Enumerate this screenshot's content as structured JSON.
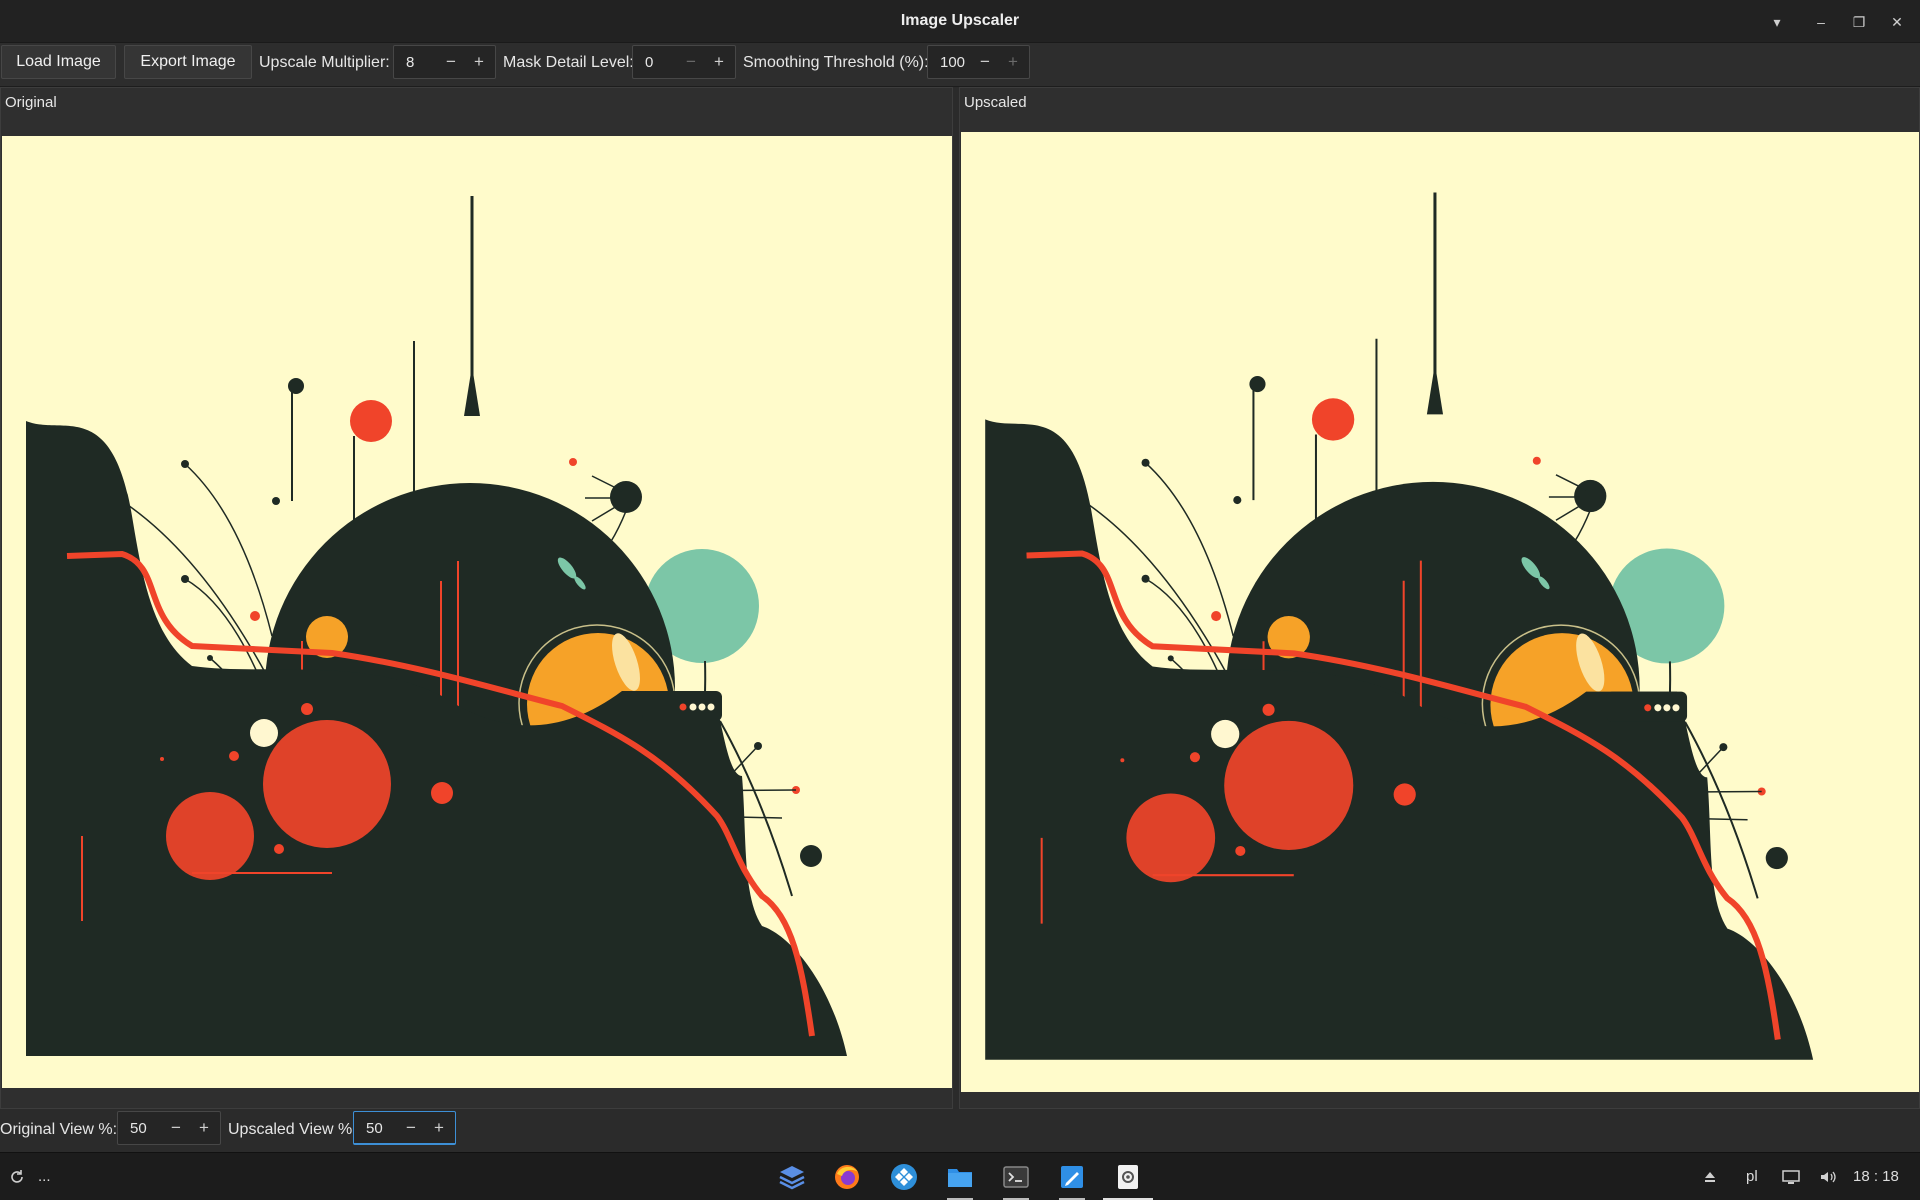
{
  "window": {
    "title": "Image Upscaler"
  },
  "toolbar": {
    "load_label": "Load Image",
    "export_label": "Export Image",
    "upscale_label": "Upscale Multiplier:",
    "upscale_value": "8",
    "mask_label": "Mask Detail Level:",
    "mask_value": "0",
    "smoothing_label": "Smoothing Threshold (%):",
    "smoothing_value": "100"
  },
  "panels": {
    "original_title": "Original",
    "upscaled_title": "Upscaled"
  },
  "bottom": {
    "original_view_label": "Original View %:",
    "original_view_value": "50",
    "upscaled_view_label": "Upscaled View %:",
    "upscaled_view_value": "50"
  },
  "taskbar": {
    "launcher_text": "...",
    "language": "pl",
    "clock": "18 : 18"
  },
  "icons": {
    "minus": "−",
    "plus": "+"
  },
  "colors": {
    "canvas_bg": "#fffbcb",
    "dark": "#1f2a24",
    "red": "#f0442a",
    "orange": "#f6a228",
    "teal": "#7cc6a7"
  }
}
